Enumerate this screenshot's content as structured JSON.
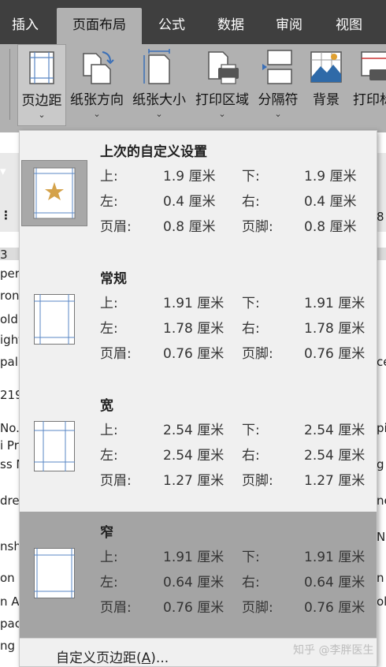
{
  "tabs": [
    "插入",
    "页面布局",
    "公式",
    "数据",
    "审阅",
    "视图"
  ],
  "ribbon": {
    "buttons": [
      {
        "label": "页边距",
        "icon": "margins-icon"
      },
      {
        "label": "纸张方向",
        "icon": "orientation-icon"
      },
      {
        "label": "纸张大小",
        "icon": "paper-size-icon"
      },
      {
        "label": "打印区域",
        "icon": "print-area-icon"
      },
      {
        "label": "分隔符",
        "icon": "breaks-icon"
      },
      {
        "label": "背景",
        "icon": "background-icon"
      },
      {
        "label": "打印标",
        "icon": "print-titles-icon"
      }
    ],
    "caret": "⌄"
  },
  "margins_menu": {
    "options": [
      {
        "name": "上次的自定义设置",
        "top_label": "上:",
        "top": "1.9 厘米",
        "bottom_label": "下:",
        "bottom": "1.9 厘米",
        "left_label": "左:",
        "left": "0.4 厘米",
        "right_label": "右:",
        "right": "0.4 厘米",
        "header_label": "页眉:",
        "header": "0.8 厘米",
        "footer_label": "页脚:",
        "footer": "0.8 厘米"
      },
      {
        "name": "常规",
        "top_label": "上:",
        "top": "1.91 厘米",
        "bottom_label": "下:",
        "bottom": "1.91 厘米",
        "left_label": "左:",
        "left": "1.78 厘米",
        "right_label": "右:",
        "right": "1.78 厘米",
        "header_label": "页眉:",
        "header": "0.76 厘米",
        "footer_label": "页脚:",
        "footer": "0.76 厘米"
      },
      {
        "name": "宽",
        "top_label": "上:",
        "top": "2.54 厘米",
        "bottom_label": "下:",
        "bottom": "2.54 厘米",
        "left_label": "左:",
        "left": "2.54 厘米",
        "right_label": "右:",
        "right": "2.54 厘米",
        "header_label": "页眉:",
        "header": "1.27 厘米",
        "footer_label": "页脚:",
        "footer": "1.27 厘米"
      },
      {
        "name": "窄",
        "top_label": "上:",
        "top": "1.91 厘米",
        "bottom_label": "下:",
        "bottom": "1.91 厘米",
        "left_label": "左:",
        "left": "0.64 厘米",
        "right_label": "右:",
        "right": "0.64 厘米",
        "header_label": "页眉:",
        "header": "0.76 厘米",
        "footer_label": "页脚:",
        "footer": "0.76 厘米"
      }
    ],
    "custom_label_pre": "自定义页边距(",
    "custom_label_key": "A",
    "custom_label_post": ")..."
  },
  "sheet_fragments": {
    "left": [
      "3",
      "per:",
      "ron",
      "old)",
      "ight",
      "pal",
      "219",
      "No.",
      "i Pr",
      "ss N",
      "dre",
      "nsh",
      "on",
      "n A",
      "pac",
      "ng"
    ],
    "right": [
      "8",
      "ce",
      "pi",
      "g",
      "ne",
      "N",
      "n",
      "ol"
    ],
    "side_icon_1": "▾",
    "side_icon_2": "⋮"
  },
  "watermark": "知乎 @李胖医生",
  "colors": {
    "tabbar": "#3f3f3f",
    "ribbon": "#b1b1b1",
    "panel": "#f0f0f0",
    "highlight": "#a4a4a4",
    "star": "#d4a24a",
    "margin_line": "#5a87c4"
  }
}
